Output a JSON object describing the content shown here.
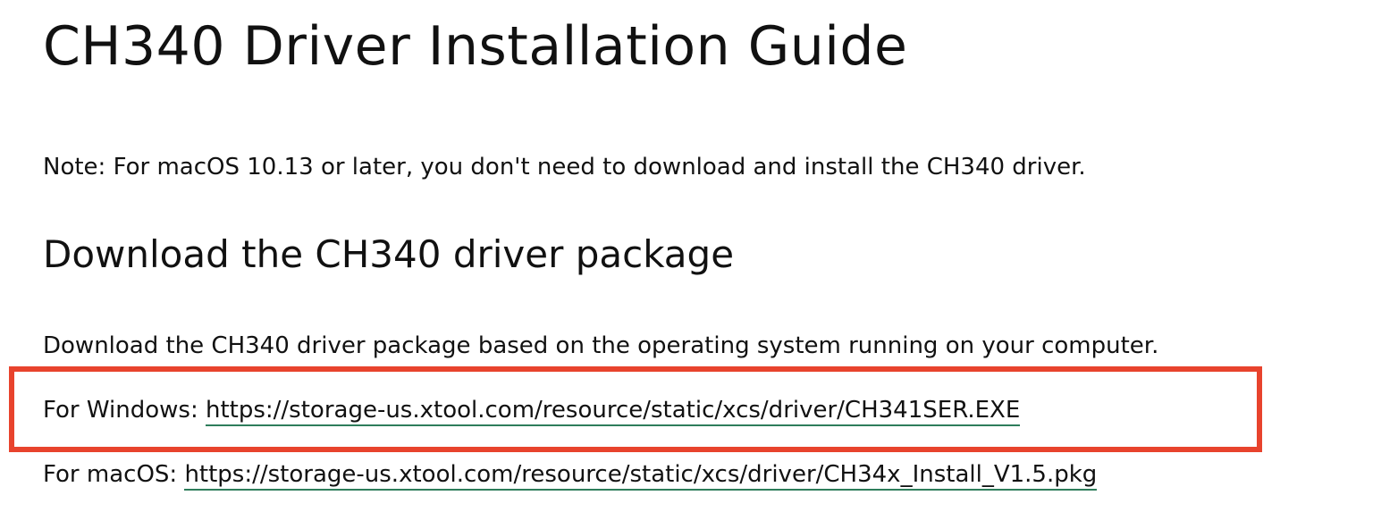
{
  "page": {
    "title": "CH340 Driver Installation Guide",
    "note": "Note: For macOS 10.13 or later, you don't need to download and install the CH340 driver.",
    "section_heading": "Download the CH340 driver package",
    "intro": "Download the CH340 driver package based on the operating system running on your computer."
  },
  "downloads": {
    "windows": {
      "label": "For Windows: ",
      "url": "https://storage-us.xtool.com/resource/static/xcs/driver/CH341SER.EXE"
    },
    "macos": {
      "label": "For macOS: ",
      "url": "https://storage-us.xtool.com/resource/static/xcs/driver/CH34x_Install_V1.5.pkg"
    }
  },
  "colors": {
    "highlight_border": "#e8432d",
    "link_underline": "#2e7d5b",
    "text": "#111111"
  }
}
